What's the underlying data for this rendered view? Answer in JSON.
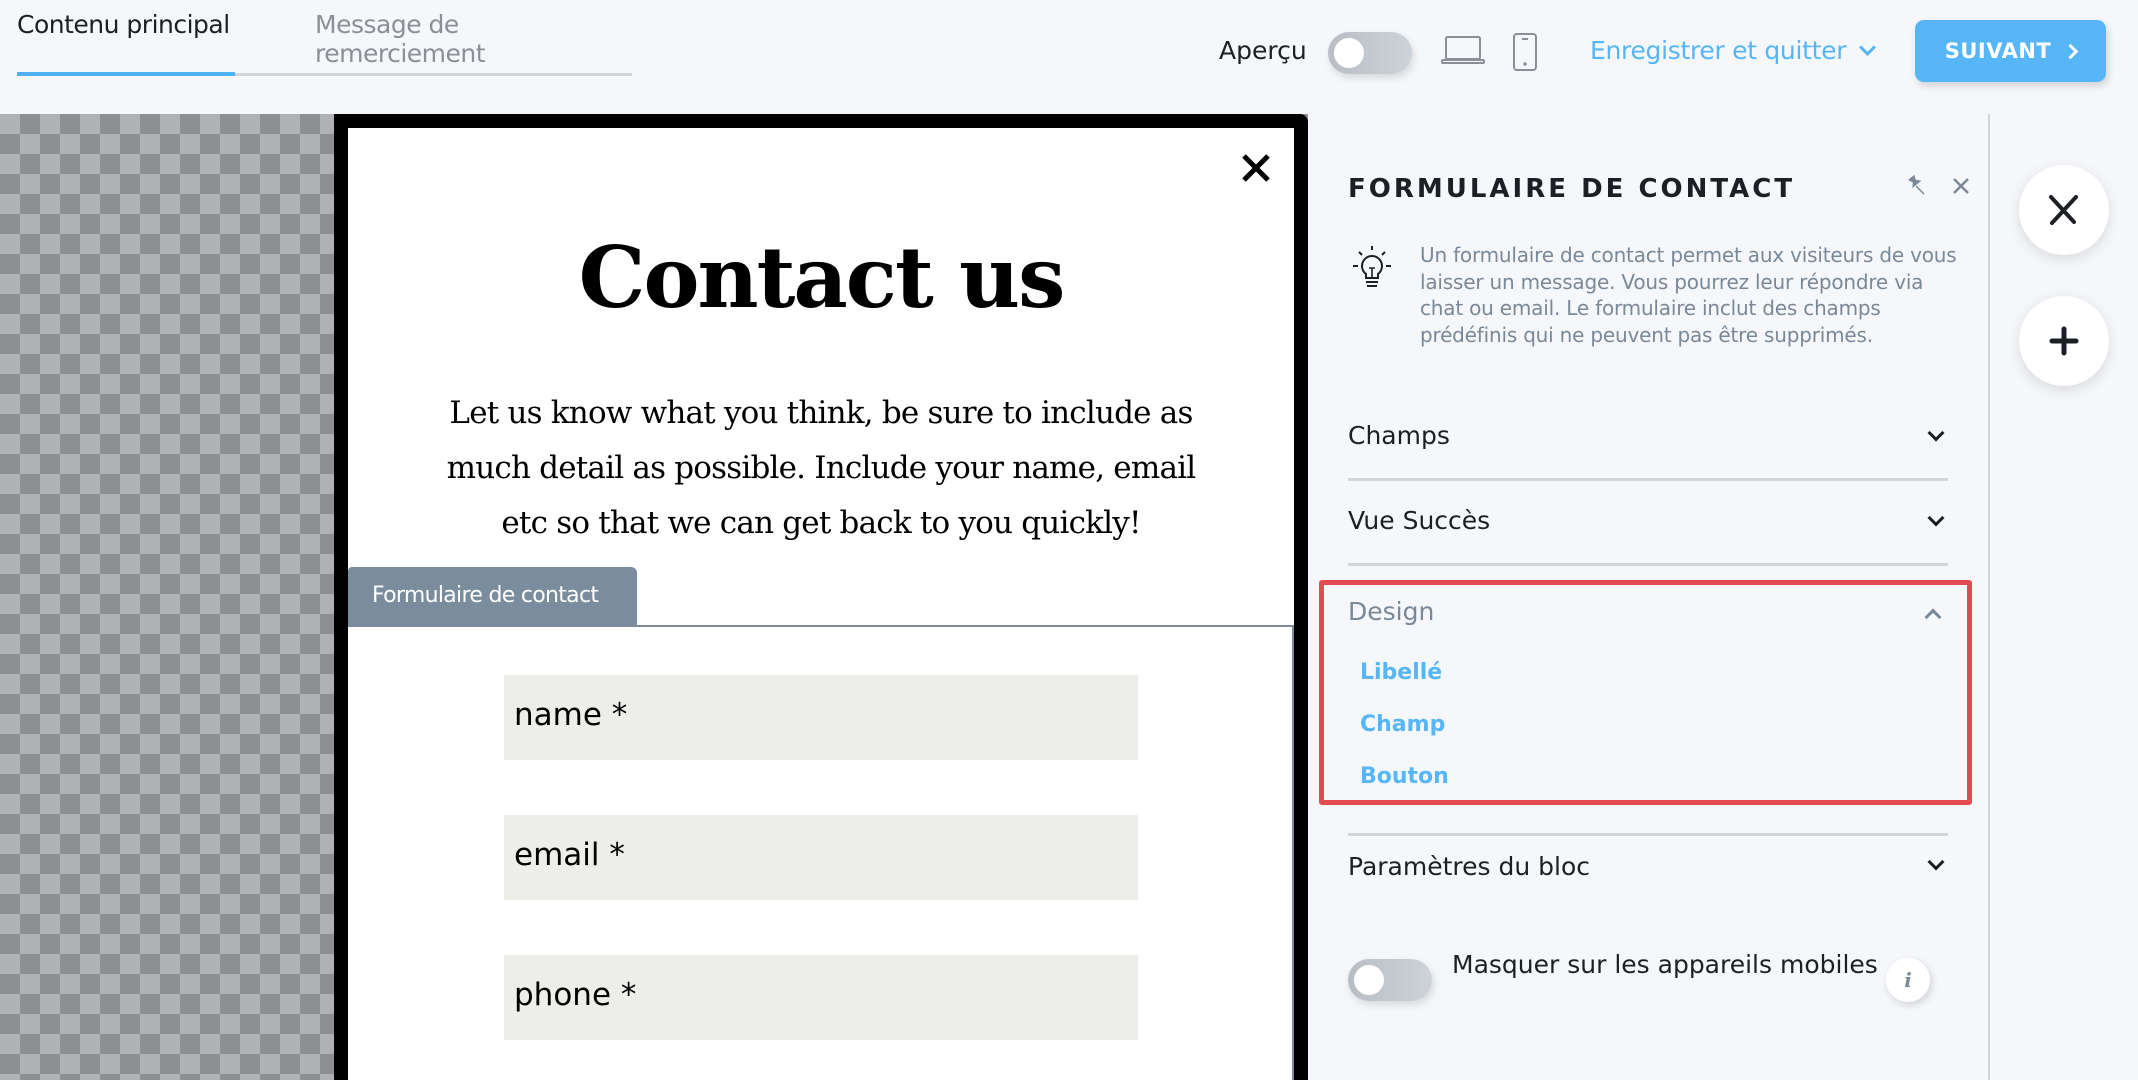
{
  "header": {
    "tabs": [
      {
        "label": "Contenu principal",
        "active": true
      },
      {
        "label": "Message de remerciement",
        "active": false
      }
    ],
    "preview_label": "Aperçu",
    "preview_toggle_on": false,
    "device_icons": [
      "laptop-icon",
      "phone-icon"
    ],
    "save_quit_label": "Enregistrer et quitter",
    "next_label": "SUIVANT"
  },
  "popup": {
    "title": "Contact us",
    "description": "Let us know what you think, be sure to include as much detail as possible. Include your name, email etc so that we can get back to you quickly!",
    "form_tab_label": "Formulaire de contact",
    "fields": [
      {
        "placeholder": "name *"
      },
      {
        "placeholder": "email *"
      },
      {
        "placeholder": "phone *"
      }
    ]
  },
  "panel": {
    "title": "FORMULAIRE DE CONTACT",
    "info": "Un formulaire de contact permet aux visiteurs de vous laisser un message. Vous pourrez leur répondre via chat ou email. Le formulaire inclut des champs prédéfinis qui ne peuvent pas être supprimés.",
    "sections": [
      {
        "label": "Champs",
        "expanded": false
      },
      {
        "label": "Vue Succès",
        "expanded": false
      },
      {
        "label": "Design",
        "expanded": true,
        "items": [
          "Libellé",
          "Champ",
          "Bouton"
        ]
      },
      {
        "label": "Paramètres du bloc",
        "expanded": false
      }
    ],
    "mobile_hide_label": "Masquer sur les appareils mobiles",
    "mobile_hide_on": false,
    "info_button": "i"
  },
  "colors": {
    "accent": "#56b6f7",
    "highlight": "#e24b4f",
    "form_tab": "#7b8d9c",
    "field_bg": "#ededea"
  }
}
